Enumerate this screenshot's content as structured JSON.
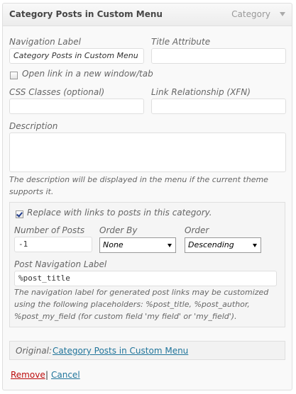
{
  "header": {
    "title": "Category Posts in Custom Menu",
    "type": "Category",
    "toggle_icon": "triangle-down-icon"
  },
  "fields": {
    "navigation_label": {
      "label": "Navigation Label",
      "value": "Category Posts in Custom Menu"
    },
    "title_attribute": {
      "label": "Title Attribute",
      "value": ""
    },
    "open_new_window": {
      "label": "Open link in a new window/tab",
      "checked": false
    },
    "css_classes": {
      "label": "CSS Classes (optional)",
      "value": ""
    },
    "link_relationship": {
      "label": "Link Relationship (XFN)",
      "value": ""
    },
    "description": {
      "label": "Description",
      "value": "",
      "note_line1": "The description will be displayed in the menu if the current theme",
      "note_line2": "supports it."
    }
  },
  "category_posts": {
    "replace_label": "Replace with links to posts in this category.",
    "replace_checked": true,
    "number_of_posts": {
      "label": "Number of Posts",
      "value": "-1"
    },
    "order_by": {
      "label": "Order By",
      "selected": "None"
    },
    "order": {
      "label": "Order",
      "selected": "Descending"
    },
    "post_nav_label": {
      "label": "Post Navigation Label",
      "value": "%post_title"
    },
    "note_line1": "The navigation label for generated post links may be customized",
    "note_line2": "using the following placeholders: %post_title, %post_author,",
    "note_line3": "%post_my_field (for custom field 'my field' or 'my_field')."
  },
  "original": {
    "label": "Original:",
    "link": "Category Posts in Custom Menu"
  },
  "actions": {
    "remove": "Remove",
    "separator": "|",
    "cancel": "Cancel"
  },
  "colors": {
    "link": "#21759b",
    "remove": "#bc0b0b"
  }
}
